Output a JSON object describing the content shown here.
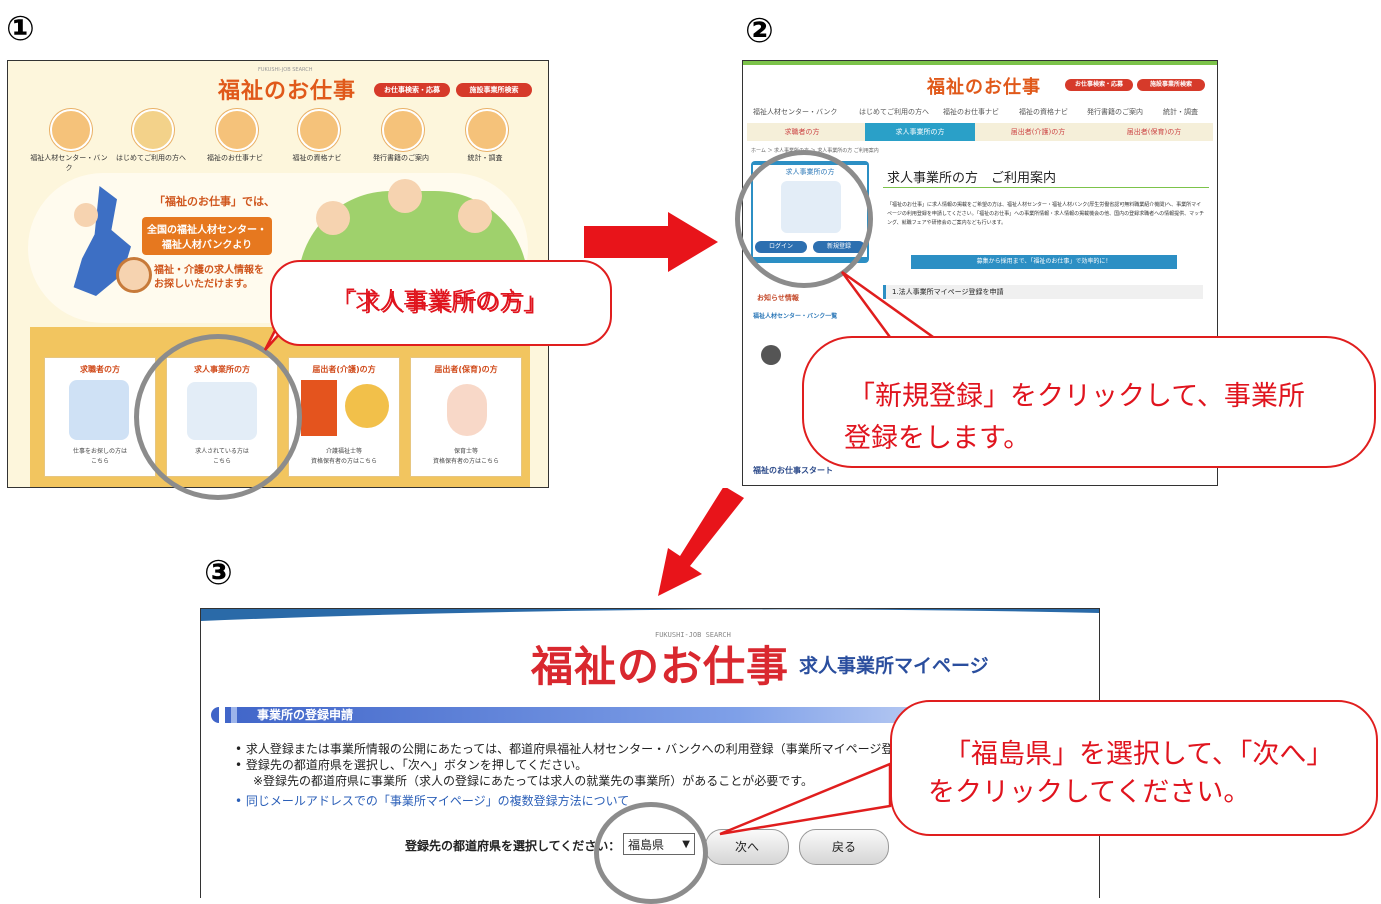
{
  "steps": {
    "one": "①",
    "two": "②",
    "three": "③"
  },
  "shot1": {
    "logo": "福祉のお仕事",
    "logo_sub": "FUKUSHI-JOB SEARCH",
    "header_btn1": "お仕事検索・応募",
    "header_btn2": "施設事業所検索",
    "nav": [
      "福祉人材センター・バンク",
      "はじめてご利用の方へ",
      "福祉のお仕事ナビ",
      "福祉の資格ナビ",
      "発行書籍のご案内",
      "統計・調査"
    ],
    "hero_line1": "「福祉のお仕事」では、",
    "hero_line2": "全国の福祉人材センター・",
    "hero_line3": "福祉人材バンクより",
    "hero_line4": "福祉・介護の求人情報を",
    "hero_line5": "お探しいただけます。",
    "cards": [
      {
        "title": "求職者の方",
        "text1": "仕事をお探しの方は",
        "text2": "こちら"
      },
      {
        "title": "求人事業所の方",
        "text1": "求人されている方は",
        "text2": "こちら"
      },
      {
        "title": "届出者(介護)の方",
        "text1": "介護福祉士等",
        "text2": "資格保有者の方はこちら"
      },
      {
        "title": "届出者(保育)の方",
        "text1": "保育士等",
        "text2": "資格保有者の方はこちら"
      }
    ],
    "callout": "「求人事業所の方」"
  },
  "shot2": {
    "logo": "福祉のお仕事",
    "header_btn1": "お仕事検索・応募",
    "header_btn2": "施設事業所検索",
    "nav": [
      "福祉人材センター・バンク",
      "はじめてご利用の方へ",
      "福祉のお仕事ナビ",
      "福祉の資格ナビ",
      "発行書籍のご案内",
      "統計・調査"
    ],
    "tabs": [
      "求職者の方",
      "求人事業所の方",
      "届出者(介護)の方",
      "届出者(保育)の方"
    ],
    "breadcrumb": "ホーム ＞ 求人事業所の方 ＞ 求人事業所の方 ご利用案内",
    "side_title": "求人事業所の方",
    "side_login": "ログイン",
    "side_register": "新規登録",
    "side_news_title": "お知らせ情報",
    "side_list_title": "福祉人材センター・バンク一覧",
    "side_footer": "福祉のお仕事スタート",
    "page_title": "求人事業所の方　ご利用案内",
    "intro": "「福祉のお仕事」に求人情報の掲載をご希望の方は、福祉人材センター・福祉人材バンク(厚生労働省認可無料職業紹介機関)へ、事業所マイページの利用登録を申請してください。「福祉のお仕事」への事業所情報・求人情報の掲載機会の他、国内の登録求職者への情報提供、マッチング、就職フェアや研修会のご案内なども行います。",
    "banner": "募集から採用まで、「福祉のお仕事」で効率的に！",
    "section1": "1.法人事業所マイページ登録を申請",
    "callout_line1": "「新規登録」をクリックして、事業所",
    "callout_line2": "登録をします。"
  },
  "shot3": {
    "logo": "福祉のお仕事",
    "logo_sub": "FUKUSHI-JOB SEARCH",
    "mypage_title": "求人事業所マイページ",
    "section_title": "事業所の登録申請",
    "bullet1": "求人登録または事業所情報の公開にあたっては、都道府県福祉人材センター・バンクへの利用登録（事業所マイページ登",
    "bullet2": "登録先の都道府県を選択し、「次へ」ボタンを押してください。",
    "note": "※登録先の都道府県に事業所（求人の登録にあたっては求人の就業先の事業所）があることが必要です。",
    "link": "同じメールアドレスでの「事業所マイページ」の複数登録方法について",
    "select_label": "登録先の都道府県を選択してください：",
    "select_value": "福島県",
    "next_button": "次へ",
    "back_button": "戻る",
    "callout_line1": "「福島県」を選択して、「次へ」",
    "callout_line2": "をクリックしてください。"
  },
  "colors": {
    "red_arrow": "#e8141a",
    "callout_border": "#e01e1e",
    "highlight_circle": "#8c8c8c",
    "brand_orange": "#e0591a",
    "section_blue": "#3f64c8"
  }
}
